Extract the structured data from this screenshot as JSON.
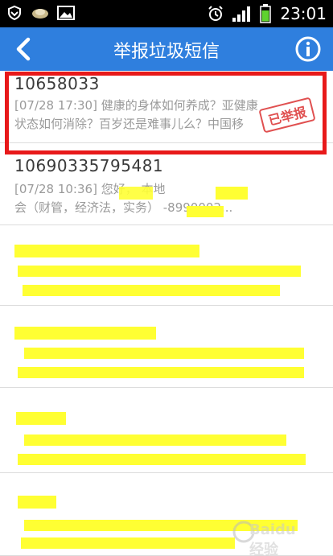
{
  "status_bar": {
    "time": "23:01",
    "battery_level": 0.7,
    "icons": [
      "shield-icon",
      "cloud-weather-icon",
      "image-icon",
      "alarm-clock-icon",
      "signal-icon",
      "battery-icon"
    ]
  },
  "title_bar": {
    "title": "举报垃圾短信",
    "back_icon": "chevron-left-icon",
    "info_icon": "info-circle-icon",
    "bg_color": "#2f7fde"
  },
  "messages": [
    {
      "number": "10658033",
      "preview_line1": "[07/28 17:30] 健康的身体如何养成？亚健康",
      "preview_line2": "状态如何消除？百岁还是难事儿么？中国移"
    },
    {
      "number": "10690335795481",
      "preview_line1": "[07/28 10:36]          您好，           本地     ",
      "preview_line2": "会（财管，经济法，实务）       -8990002...",
      "badge": "已举报"
    },
    {
      "number": "",
      "preview_line1": "",
      "preview_line2": ""
    },
    {
      "number": "",
      "preview_line1": "",
      "preview_line2": ""
    },
    {
      "number": "",
      "preview_line1": "",
      "preview_line2": ""
    },
    {
      "number": "",
      "preview_line1": "",
      "preview_line2": ""
    }
  ],
  "highlight_color": "#ffff33",
  "frame_color": "#e8191a"
}
